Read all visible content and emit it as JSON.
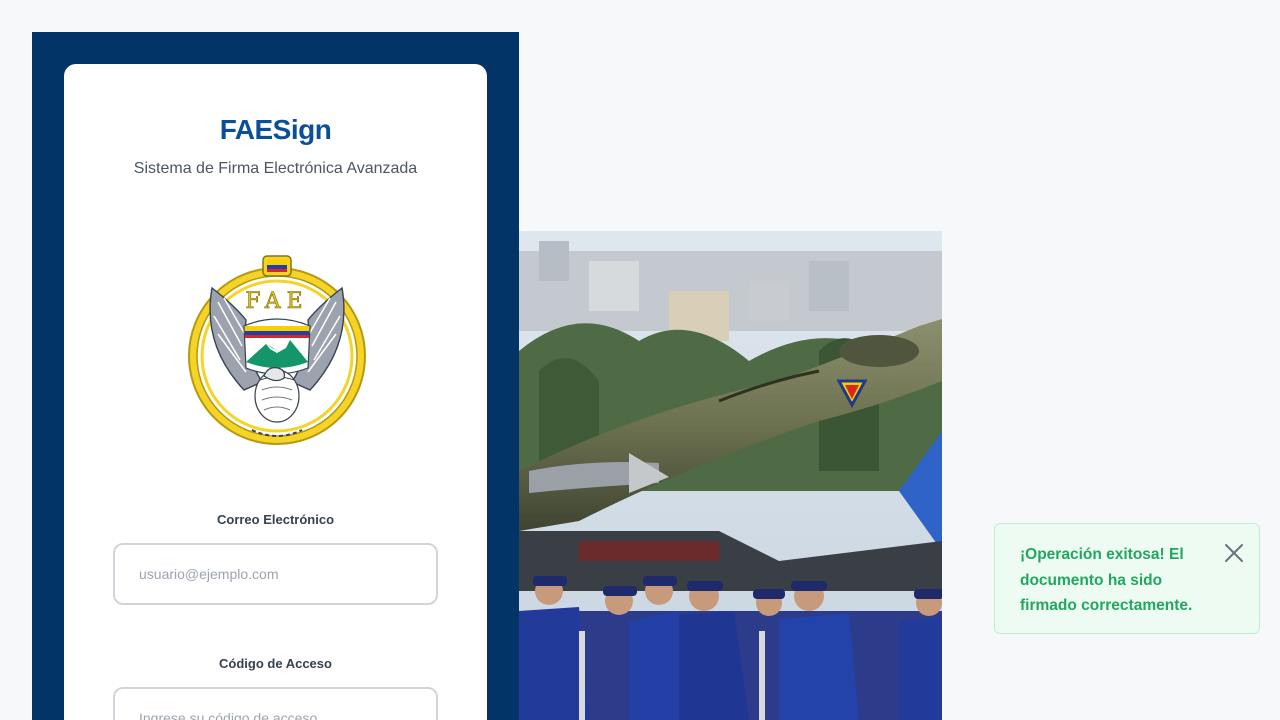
{
  "app": {
    "title": "FAESign",
    "subtitle": "Sistema de Firma Electrónica Avanzada"
  },
  "emblem": {
    "icon": "fae-emblem-icon",
    "text": "FAE"
  },
  "form": {
    "email": {
      "label": "Correo Electrónico",
      "placeholder": "usuario@ejemplo.com",
      "value": ""
    },
    "access_code": {
      "label": "Código de Acceso",
      "placeholder": "Ingrese su código de acceso",
      "value": ""
    }
  },
  "toast": {
    "message": "¡Operación exitosa! El documento ha sido firmado correctamente.",
    "close_icon": "close-icon"
  },
  "colors": {
    "panel": "#033468",
    "brand": "#0b4f9a",
    "success_text": "#21a760",
    "success_bg": "#edfbf2"
  }
}
